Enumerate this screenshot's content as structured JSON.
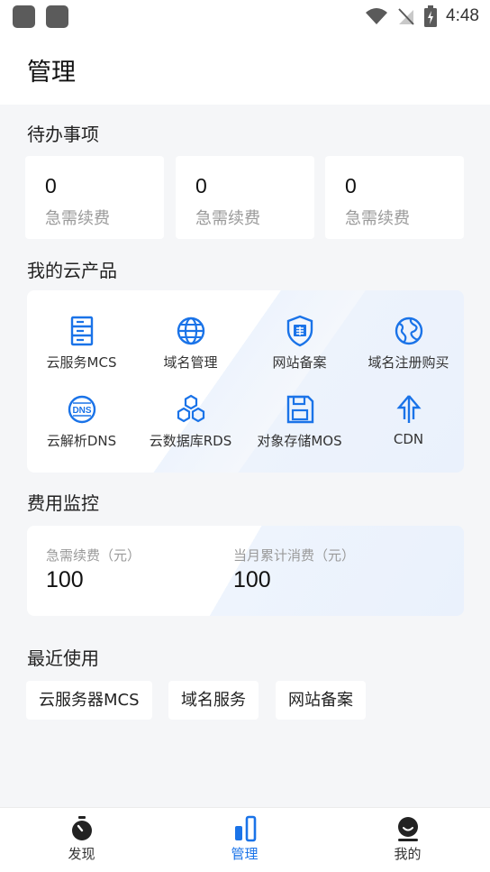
{
  "status_bar": {
    "time": "4:48"
  },
  "header": {
    "title": "管理"
  },
  "todo": {
    "title": "待办事项",
    "cards": [
      {
        "value": "0",
        "label": "急需续费"
      },
      {
        "value": "0",
        "label": "急需续费"
      },
      {
        "value": "0",
        "label": "急需续费"
      }
    ]
  },
  "products": {
    "title": "我的云产品",
    "items": [
      {
        "label": "云服务MCS",
        "icon": "server-icon"
      },
      {
        "label": "域名管理",
        "icon": "globe-icon"
      },
      {
        "label": "网站备案",
        "icon": "shield-icon"
      },
      {
        "label": "域名注册购买",
        "icon": "earth-icon"
      },
      {
        "label": "云解析DNS",
        "icon": "dns-icon"
      },
      {
        "label": "云数据库RDS",
        "icon": "database-icon"
      },
      {
        "label": "对象存储MOS",
        "icon": "save-icon"
      },
      {
        "label": "CDN",
        "icon": "cdn-icon"
      }
    ]
  },
  "cost": {
    "title": "费用监控",
    "renewal_label": "急需续费（元）",
    "renewal_value": "100",
    "monthly_label": "当月累计消费（元）",
    "monthly_value": "100"
  },
  "recent": {
    "title": "最近使用",
    "items": [
      "云服务器MCS",
      "域名服务",
      "网站备案"
    ]
  },
  "bottom_nav": {
    "items": [
      {
        "label": "发现",
        "icon": "stopwatch-icon"
      },
      {
        "label": "管理",
        "icon": "manage-icon",
        "active": true
      },
      {
        "label": "我的",
        "icon": "profile-icon"
      }
    ]
  },
  "colors": {
    "accent": "#1a73e8",
    "background": "#f5f6f8",
    "muted_text": "#9a9a9a"
  }
}
